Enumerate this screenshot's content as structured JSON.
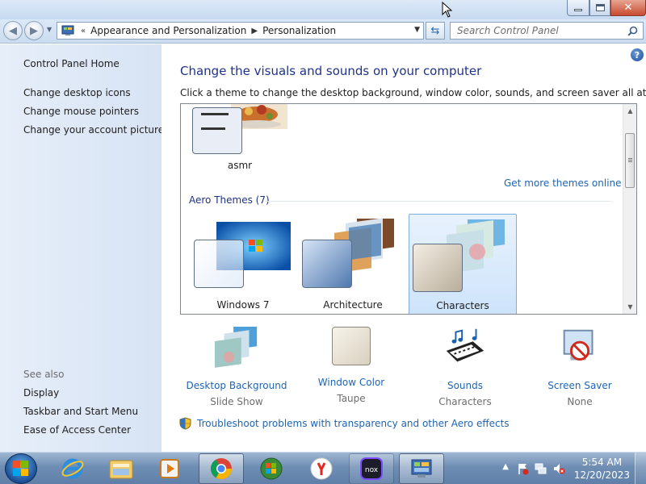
{
  "address": {
    "history_glyph": "«",
    "crumbs": [
      "Appearance and Personalization",
      "Personalization"
    ],
    "search_placeholder": "Search Control Panel"
  },
  "sidebar": {
    "home": "Control Panel Home",
    "links": [
      "Change desktop icons",
      "Change mouse pointers",
      "Change your account picture"
    ],
    "see_also_heading": "See also",
    "see_also": [
      "Display",
      "Taskbar and Start Menu",
      "Ease of Access Center"
    ]
  },
  "main": {
    "title": "Change the visuals and sounds on your computer",
    "subtitle": "Click a theme to change the desktop background, window color, sounds, and screen saver all at once.",
    "my_theme": "asmr",
    "more_themes_link": "Get more themes online",
    "aero_heading": "Aero Themes (7)",
    "aero_themes": [
      "Windows 7",
      "Architecture",
      "Characters"
    ],
    "selected_theme": "Characters"
  },
  "features": [
    {
      "name": "Desktop Background",
      "value": "Slide Show"
    },
    {
      "name": "Window Color",
      "value": "Taupe"
    },
    {
      "name": "Sounds",
      "value": "Characters"
    },
    {
      "name": "Screen Saver",
      "value": "None"
    }
  ],
  "troubleshoot_link": "Troubleshoot problems with transparency and other Aero effects",
  "taskbar": {
    "pinned": [
      "internet-explorer",
      "windows-explorer",
      "media-player",
      "chrome",
      "windows-logo-app",
      "yandex",
      "nox",
      "control-panel"
    ],
    "time": "5:54 AM",
    "date": "12/20/2023"
  },
  "colors": {
    "link": "#1e64b4",
    "heading": "#1e3287",
    "sidebar": "#dce7f6",
    "taskbar": "#6f8eb4"
  }
}
